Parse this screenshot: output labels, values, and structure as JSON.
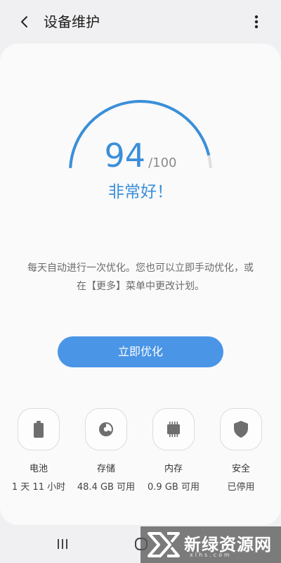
{
  "header": {
    "title": "设备维护"
  },
  "gauge": {
    "score": "94",
    "max": "/100",
    "fraction": 0.94,
    "status": "非常好！",
    "color": "#3b8fd9"
  },
  "description": "每天自动进行一次优化。您也可以立即手动优化，或在【更多】菜单中更改计划。",
  "optimize_button": {
    "label": "立即优化",
    "color": "#4a95e6"
  },
  "items": [
    {
      "icon": "battery-icon",
      "label": "电池",
      "value": "1 天 11 小时"
    },
    {
      "icon": "storage-icon",
      "label": "存储",
      "value": "48.4 GB 可用"
    },
    {
      "icon": "memory-icon",
      "label": "内存",
      "value": "0.9 GB 可用"
    },
    {
      "icon": "shield-icon",
      "label": "安全",
      "value": "已停用"
    }
  ],
  "watermark": {
    "text": "新绿资源网",
    "sub": "xlhs.com"
  }
}
